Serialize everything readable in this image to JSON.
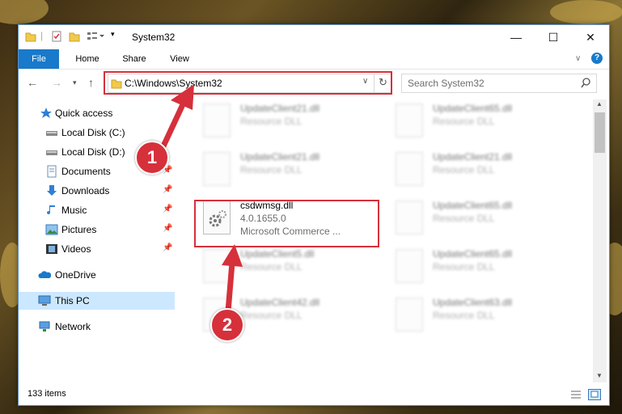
{
  "window": {
    "title": "System32",
    "controls": {
      "minimize": "—",
      "maximize": "☐",
      "close": "✕"
    }
  },
  "ribbon": {
    "tabs": [
      "File",
      "Home",
      "Share",
      "View"
    ],
    "help": "?"
  },
  "address_bar": {
    "path": "C:\\Windows\\System32",
    "search_placeholder": "Search System32"
  },
  "nav_pane": {
    "items": [
      {
        "label": "Quick access",
        "icon": "star-icon"
      },
      {
        "label": "Local Disk (C:)",
        "icon": "drive-icon"
      },
      {
        "label": "Local Disk (D:)",
        "icon": "drive-icon"
      },
      {
        "label": "Documents",
        "icon": "documents-icon",
        "pinned": true
      },
      {
        "label": "Downloads",
        "icon": "downloads-icon",
        "pinned": true
      },
      {
        "label": "Music",
        "icon": "music-icon",
        "pinned": true
      },
      {
        "label": "Pictures",
        "icon": "pictures-icon",
        "pinned": true
      },
      {
        "label": "Videos",
        "icon": "videos-icon",
        "pinned": true
      },
      {
        "label": "OneDrive",
        "icon": "onedrive-icon"
      },
      {
        "label": "This PC",
        "icon": "this-pc-icon",
        "selected": true
      },
      {
        "label": "Network",
        "icon": "network-icon"
      }
    ]
  },
  "files": {
    "blurred": [
      {
        "name": "UpdateClient21.dll",
        "type": "Resource DLL"
      },
      {
        "name": "UpdateClient65.dll",
        "type": "Resource DLL"
      },
      {
        "name": "UpdateClient21.dll",
        "type": "Resource DLL"
      },
      {
        "name": "UpdateClient21.dll",
        "type": "Resource DLL"
      },
      {
        "name": "UpdateClient65.dll",
        "type": "Resource DLL"
      },
      {
        "name": "UpdateClient5.dll",
        "type": "Resource DLL"
      },
      {
        "name": "UpdateClient65.dll",
        "type": "Resource DLL"
      },
      {
        "name": "UpdateClient42.dll",
        "type": "Resource DLL"
      },
      {
        "name": "UpdateClient63.dll",
        "type": "Resource DLL"
      }
    ],
    "highlighted": {
      "name": "csdwmsg.dll",
      "version": "4.0.1655.0",
      "company": "Microsoft Commerce ..."
    }
  },
  "status_bar": {
    "count": "133 items"
  },
  "annotations": {
    "step1": "1",
    "step2": "2"
  },
  "colors": {
    "accent": "#1979ca",
    "highlight": "#d6303b",
    "selected": "#cce8ff"
  }
}
